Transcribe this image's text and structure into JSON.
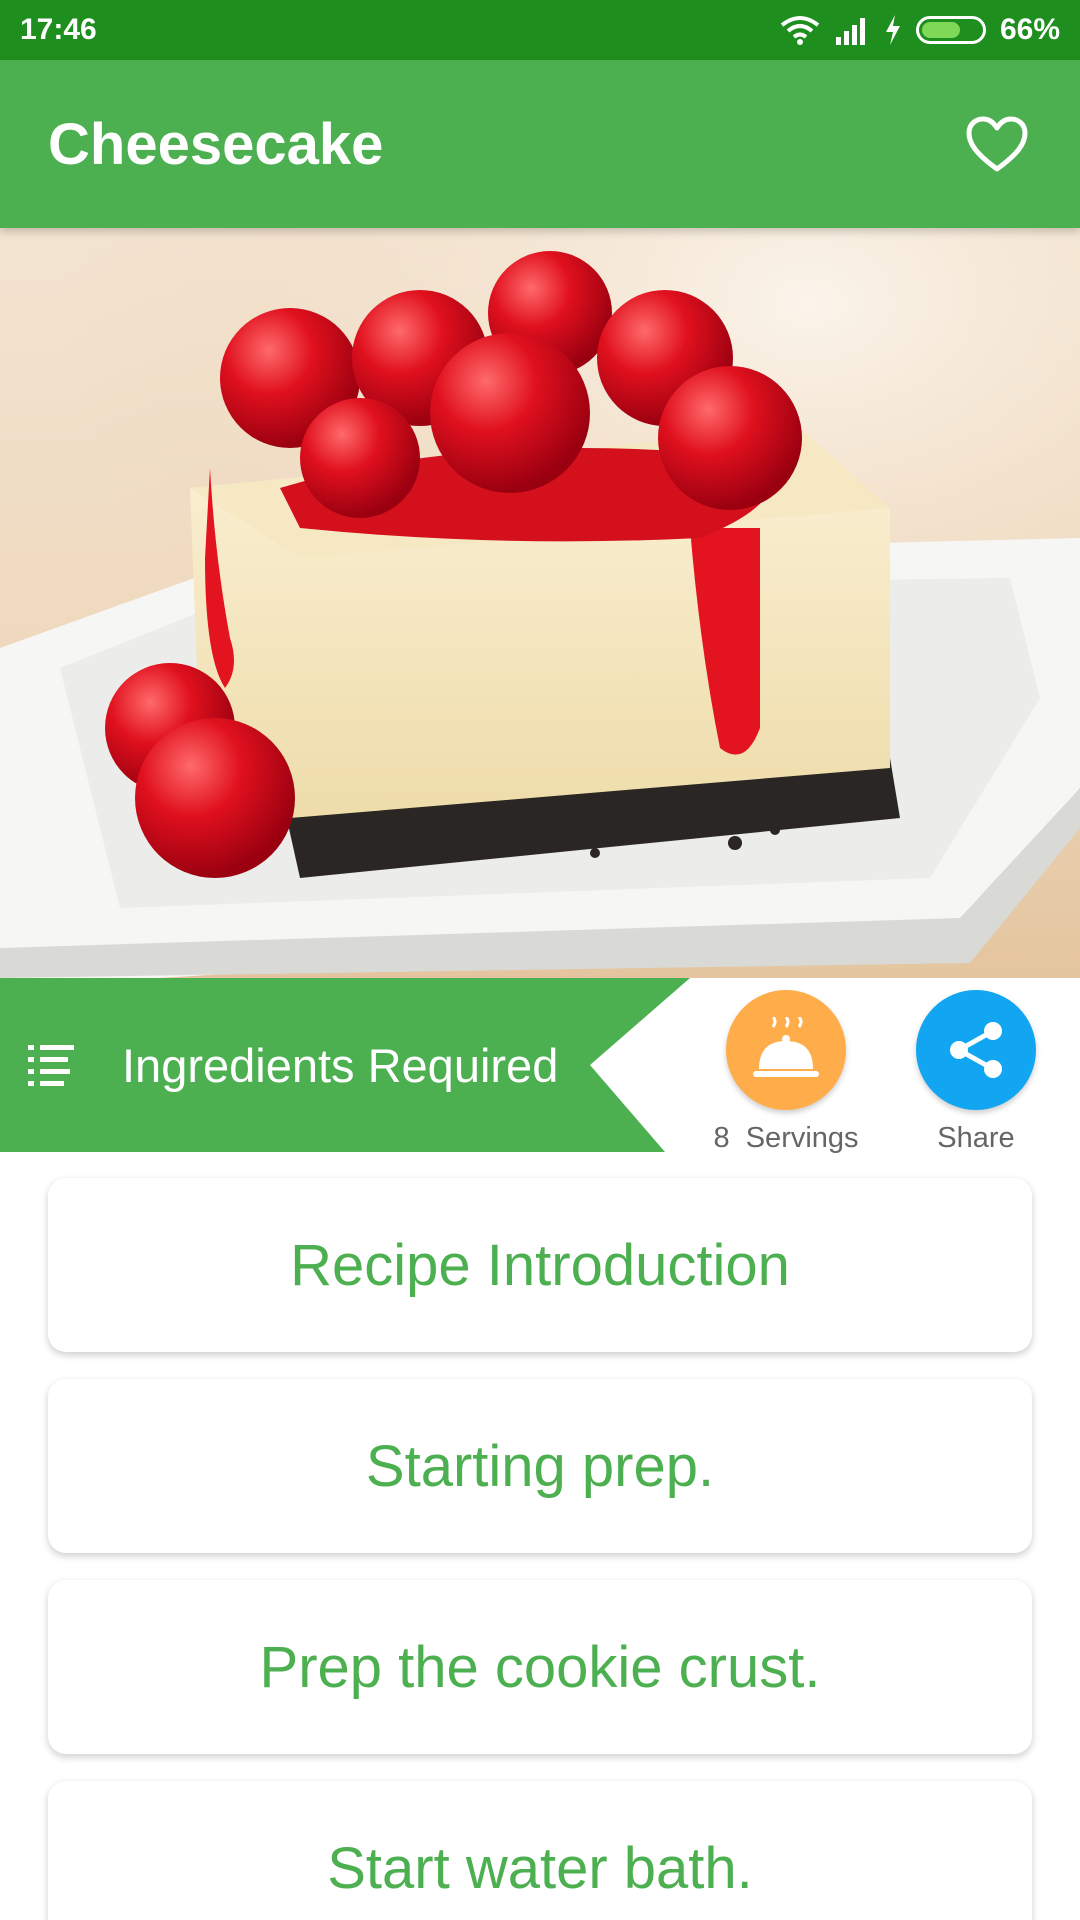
{
  "status_bar": {
    "time": "17:46",
    "battery": "66%"
  },
  "app_bar": {
    "title": "Cheesecake"
  },
  "section": {
    "label": "Ingredients Required"
  },
  "servings": {
    "count": "8",
    "label": "Servings"
  },
  "share": {
    "label": "Share"
  },
  "steps": [
    {
      "label": "Recipe Introduction"
    },
    {
      "label": "Starting prep."
    },
    {
      "label": "Prep the cookie crust."
    },
    {
      "label": "Start water bath."
    }
  ],
  "colors": {
    "primary": "#4caf50",
    "status_bar": "#1e8e1e",
    "servings": "#ffad4a",
    "share": "#12a6f2"
  }
}
